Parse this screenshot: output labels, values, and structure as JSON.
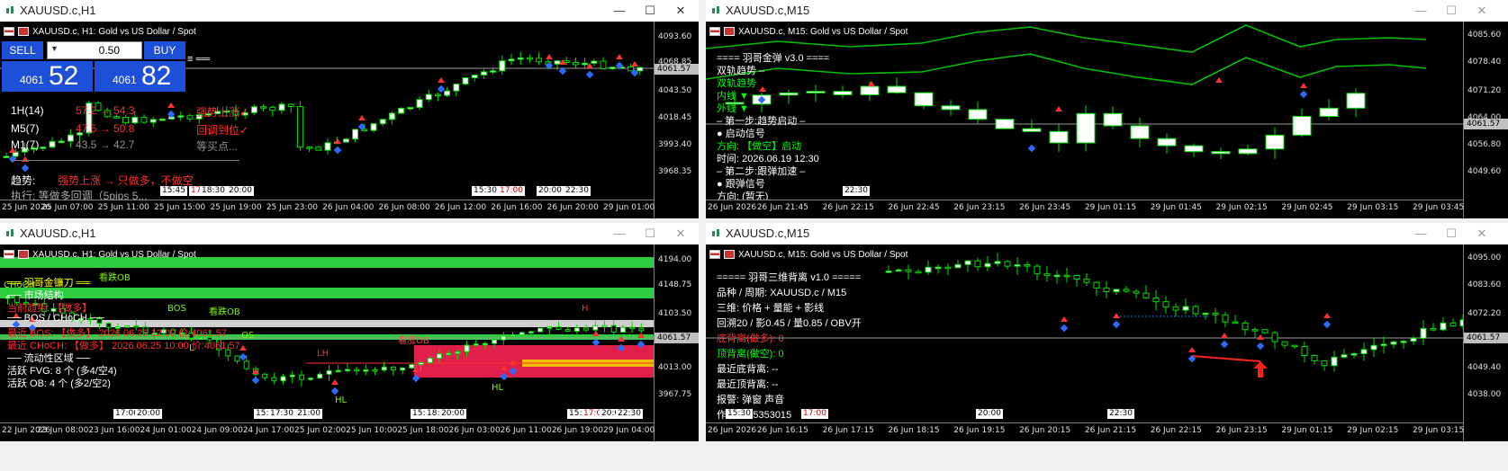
{
  "windows": [
    {
      "title": "XAUUSD.c,H1",
      "symbol_header": "XAUUSD.c, H1:  Gold vs US Dollar / Spot",
      "controls": {
        "minimize": "—",
        "maximize": "☐",
        "close": "✕"
      },
      "trade_panel": {
        "sell_label": "SELL",
        "buy_label": "BUY",
        "lot_value": "0.50",
        "sell_price_small": "4061",
        "sell_price_big": "52",
        "buy_price_small": "4061",
        "buy_price_big": "82"
      },
      "price_ticks": [
        "4093.60",
        "4068.85",
        "4043.50",
        "4018.45",
        "3993.40",
        "3968.35"
      ],
      "current_price": "4061.57",
      "time_ticks": [
        "25 Jun 2026",
        "25 Jun 07:00",
        "25 Jun 11:00",
        "25 Jun 15:00",
        "25 Jun 19:00",
        "25 Jun 23:00",
        "26 Jun 04:00",
        "26 Jun 08:00",
        "26 Jun 12:00",
        "26 Jun 16:00",
        "26 Jun 20:00",
        "29 Jun 01:00"
      ],
      "time_boxes": [
        {
          "text": "15:45",
          "red": false
        },
        {
          "text": "17:",
          "red": true
        },
        {
          "text": "18:30",
          "red": false
        },
        {
          "text": "20:00",
          "red": false
        },
        {
          "text": "15:30",
          "red": false
        },
        {
          "text": "17:00",
          "red": true
        },
        {
          "text": "20:00",
          "red": false
        },
        {
          "text": "22:30",
          "red": false
        }
      ],
      "panel_lines": [
        {
          "label": "1H(14)",
          "value": "57.2 → 54.3",
          "status": "强势上涨✓"
        },
        {
          "label": "M5(7)",
          "value": "47.5 → 50.8",
          "status": "回调到位✓"
        },
        {
          "label": "M1(7)",
          "value": "43.5 → 42.7",
          "status": "等买点..."
        }
      ],
      "trend_label": "趋势:",
      "trend_text": "强势上涨 → 只做多，不做空",
      "bottom_text": "执行:    等做多回调（5pips 5...",
      "equals_text": "≡ ══"
    },
    {
      "title": "XAUUSD.c,M15",
      "symbol_header": "XAUUSD.c, M15:  Gold vs US Dollar / Spot",
      "controls": {
        "minimize": "—",
        "maximize": "☐",
        "close": "✕"
      },
      "price_ticks": [
        "4085.60",
        "4078.40",
        "4071.20",
        "4064.00",
        "4056.80",
        "4049.60"
      ],
      "current_price": "4061.57",
      "time_ticks": [
        "26 Jun 2026",
        "26 Jun 21:45",
        "26 Jun 22:15",
        "26 Jun 22:45",
        "26 Jun 23:15",
        "26 Jun 23:45",
        "29 Jun 01:15",
        "29 Jun 01:45",
        "29 Jun 02:15",
        "29 Jun 02:45",
        "29 Jun 03:15",
        "29 Jun 03:45"
      ],
      "time_boxes": [
        {
          "text": "22:30",
          "red": false
        }
      ],
      "panel_lines": [
        {
          "text": "==== 羽哥金弹 v3.0 ====",
          "color": "#ffffff"
        },
        {
          "text": "  双轨趋势 –",
          "color": "#ffffff"
        },
        {
          "text": "  双轨趋势",
          "color": "#00ff00"
        },
        {
          "text": "内线 ▼",
          "color": "#00ff00"
        },
        {
          "text": "外线 ▼",
          "color": "#00ff00"
        },
        {
          "text": "– 第一步:趋势启动 –",
          "color": "#ffffff"
        },
        {
          "text": "● 启动信号",
          "color": "#ffffff"
        },
        {
          "text": "方向:  【做空】启动",
          "color": "#00ff00"
        },
        {
          "text": "时间:  2026.06.19 12:30",
          "color": "#ffffff"
        },
        {
          "text": "– 第二步:跟弹加速 –",
          "color": "#ffffff"
        },
        {
          "text": "● 跟弹信号",
          "color": "#ffffff"
        },
        {
          "text": "方向:  (暂无)",
          "color": "#ffffff"
        },
        {
          "text": "时间:",
          "color": "#ffffff"
        }
      ]
    },
    {
      "title": "XAUUSD.c,H1",
      "symbol_header": "XAUUSD.c, H1:  Gold vs US Dollar / Spot",
      "controls": {
        "minimize": "—",
        "maximize": "☐",
        "close": "✕"
      },
      "price_ticks": [
        "4194.00",
        "4148.75",
        "4103.50",
        "4013.00",
        "3967.75"
      ],
      "current_price": "4061.57",
      "time_ticks": [
        "22 Jun 2026",
        "23 Jun 08:00",
        "23 Jun 16:00",
        "24 Jun 01:00",
        "24 Jun 09:00",
        "24 Jun 17:00",
        "25 Jun 02:00",
        "25 Jun 10:00",
        "25 Jun 18:00",
        "26 Jun 03:00",
        "26 Jun 11:00",
        "26 Jun 19:00",
        "29 Jun 04:00"
      ],
      "time_boxes": [
        {
          "text": "17:00",
          "red": false
        },
        {
          "text": "20:00",
          "red": false
        },
        {
          "text": "15:",
          "red": false
        },
        {
          "text": "17:30",
          "red": false
        },
        {
          "text": "21:00",
          "red": false
        },
        {
          "text": "15:",
          "red": false
        },
        {
          "text": "18:",
          "red": false
        },
        {
          "text": "20:00",
          "red": false
        },
        {
          "text": "15:",
          "red": false
        },
        {
          "text": "17:00",
          "red": true
        },
        {
          "text": "20:00",
          "red": false
        },
        {
          "text": "22:30",
          "red": false
        }
      ],
      "panel_lines": [
        {
          "text": "══ 羽哥金镰刀 ══",
          "color": "#ffff00"
        },
        {
          "text": "── 市场结构",
          "color": "#ffffff"
        },
        {
          "text": "当前趋势:  【做多】",
          "color": "#ff3030"
        },
        {
          "text": "── BOS / CHoCH ──",
          "color": "#ffffff"
        },
        {
          "text": "最近 BOS:  【做多】 2026.06.26 12:00 价:4061.57",
          "color": "#ff3030"
        },
        {
          "text": "最近 CHoCH: 【做多】 2026.06.25 10:00 价:4061.57",
          "color": "#ff3030"
        },
        {
          "text": "── 流动性区域 ──",
          "color": "#ffffff"
        },
        {
          "text": "活跃 FVG:  8 个 (多4/空4)",
          "color": "#ffffff"
        },
        {
          "text": "活跃 OB:  4 个 (多2/空2)",
          "color": "#ffffff"
        }
      ],
      "chart_labels": [
        "看跌OB",
        "BOS",
        "看跌OB",
        "看涨OB",
        "LH",
        "HL",
        "HL",
        "H",
        "L",
        "CHoCH",
        "OS"
      ]
    },
    {
      "title": "XAUUSD.c,M15",
      "symbol_header": "XAUUSD.c, M15:  Gold vs US Dollar / Spot",
      "controls": {
        "minimize": "—",
        "maximize": "☐",
        "close": "✕"
      },
      "price_ticks": [
        "4095.00",
        "4083.60",
        "4072.20",
        "4049.40",
        "4038.00"
      ],
      "current_price": "4061.57",
      "time_ticks": [
        "26 Jun 2026",
        "26 Jun 16:15",
        "26 Jun 17:15",
        "26 Jun 18:15",
        "26 Jun 19:15",
        "26 Jun 20:15",
        "26 Jun 21:15",
        "26 Jun 22:15",
        "26 Jun 23:15",
        "29 Jun 01:15",
        "29 Jun 02:15",
        "29 Jun 03:15"
      ],
      "time_boxes": [
        {
          "text": "15:30",
          "red": false
        },
        {
          "text": "17:00",
          "red": true
        },
        {
          "text": "20:00",
          "red": false
        },
        {
          "text": "22:30",
          "red": false
        }
      ],
      "panel_lines": [
        {
          "text": "===== 羽哥三维背离 v1.0 =====",
          "color": "#ffffff"
        },
        {
          "text": "品种 / 周期: XAUUSD.c / M15",
          "color": "#ffffff"
        },
        {
          "text": "三维: 价格 + 量能 + 影线",
          "color": "#ffffff"
        },
        {
          "text": "回溯20 / 影0.45 / 量0.85 / OBV开",
          "color": "#ffffff"
        },
        {
          "text": "底背离(做多): 0",
          "color": "#ff3030"
        },
        {
          "text": "顶背离(做空): 0",
          "color": "#00ff00"
        },
        {
          "text": "最近底背离: --",
          "color": "#ffffff"
        },
        {
          "text": "最近顶背离: --",
          "color": "#ffffff"
        },
        {
          "text": "报警: 弹窗 声音",
          "color": "#ffffff"
        },
        {
          "text": "作者: 945353015",
          "color": "#ffffff"
        }
      ]
    }
  ]
}
